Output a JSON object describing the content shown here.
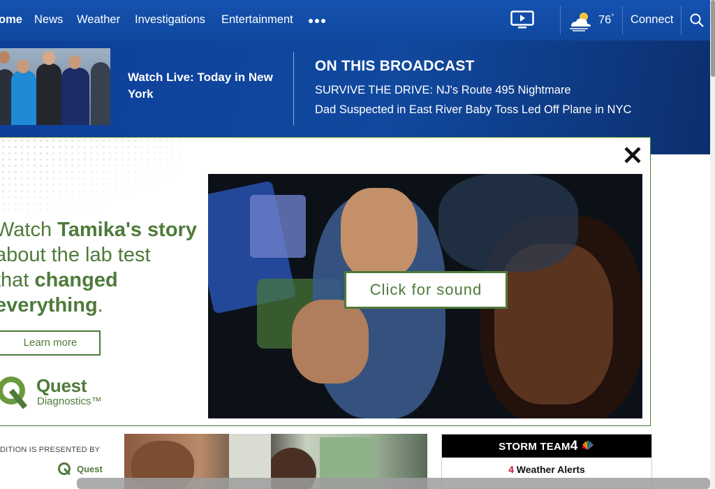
{
  "nav": {
    "items": [
      "ome",
      "News",
      "Weather",
      "Investigations",
      "Entertainment"
    ],
    "more_icon": "ellipsis-icon",
    "video_icon": "tv-play-icon",
    "weather_icon": "partly-cloudy-icon",
    "temperature": "76",
    "degree": "°",
    "connect": "Connect",
    "search_icon": "search-icon"
  },
  "broadcast": {
    "watch_live": "Watch Live: Today in New York",
    "title": "ON THIS BROADCAST",
    "links": [
      "SURVIVE THE DRIVE: NJ's Route 495 Nightmare",
      "Dad Suspected in East River Baby Toss Led Off Plane in NYC"
    ]
  },
  "ad": {
    "headline_1": "Watch ",
    "headline_bold_1": "Tamika's story",
    "headline_2": "about the lab test",
    "headline_3": "that ",
    "headline_bold_2": "changed",
    "headline_bold_3": "everything",
    "headline_4": ".",
    "learn_more": "Learn more",
    "brand_name": "Quest",
    "brand_sub": "Diagnostics™",
    "click_for_sound": "Click for sound",
    "close_icon": "close-icon",
    "accent_color": "#4e7a3a"
  },
  "lower": {
    "sponsor_text": "DITION IS PRESENTED BY",
    "sponsor_name": "Quest",
    "storm_team": "STORM TEAM",
    "storm_four": "4",
    "alerts_count": "4",
    "alerts_label": " Weather Alerts"
  },
  "colors": {
    "nav_blue": "#0e489f",
    "alert_red": "#c8102e"
  }
}
